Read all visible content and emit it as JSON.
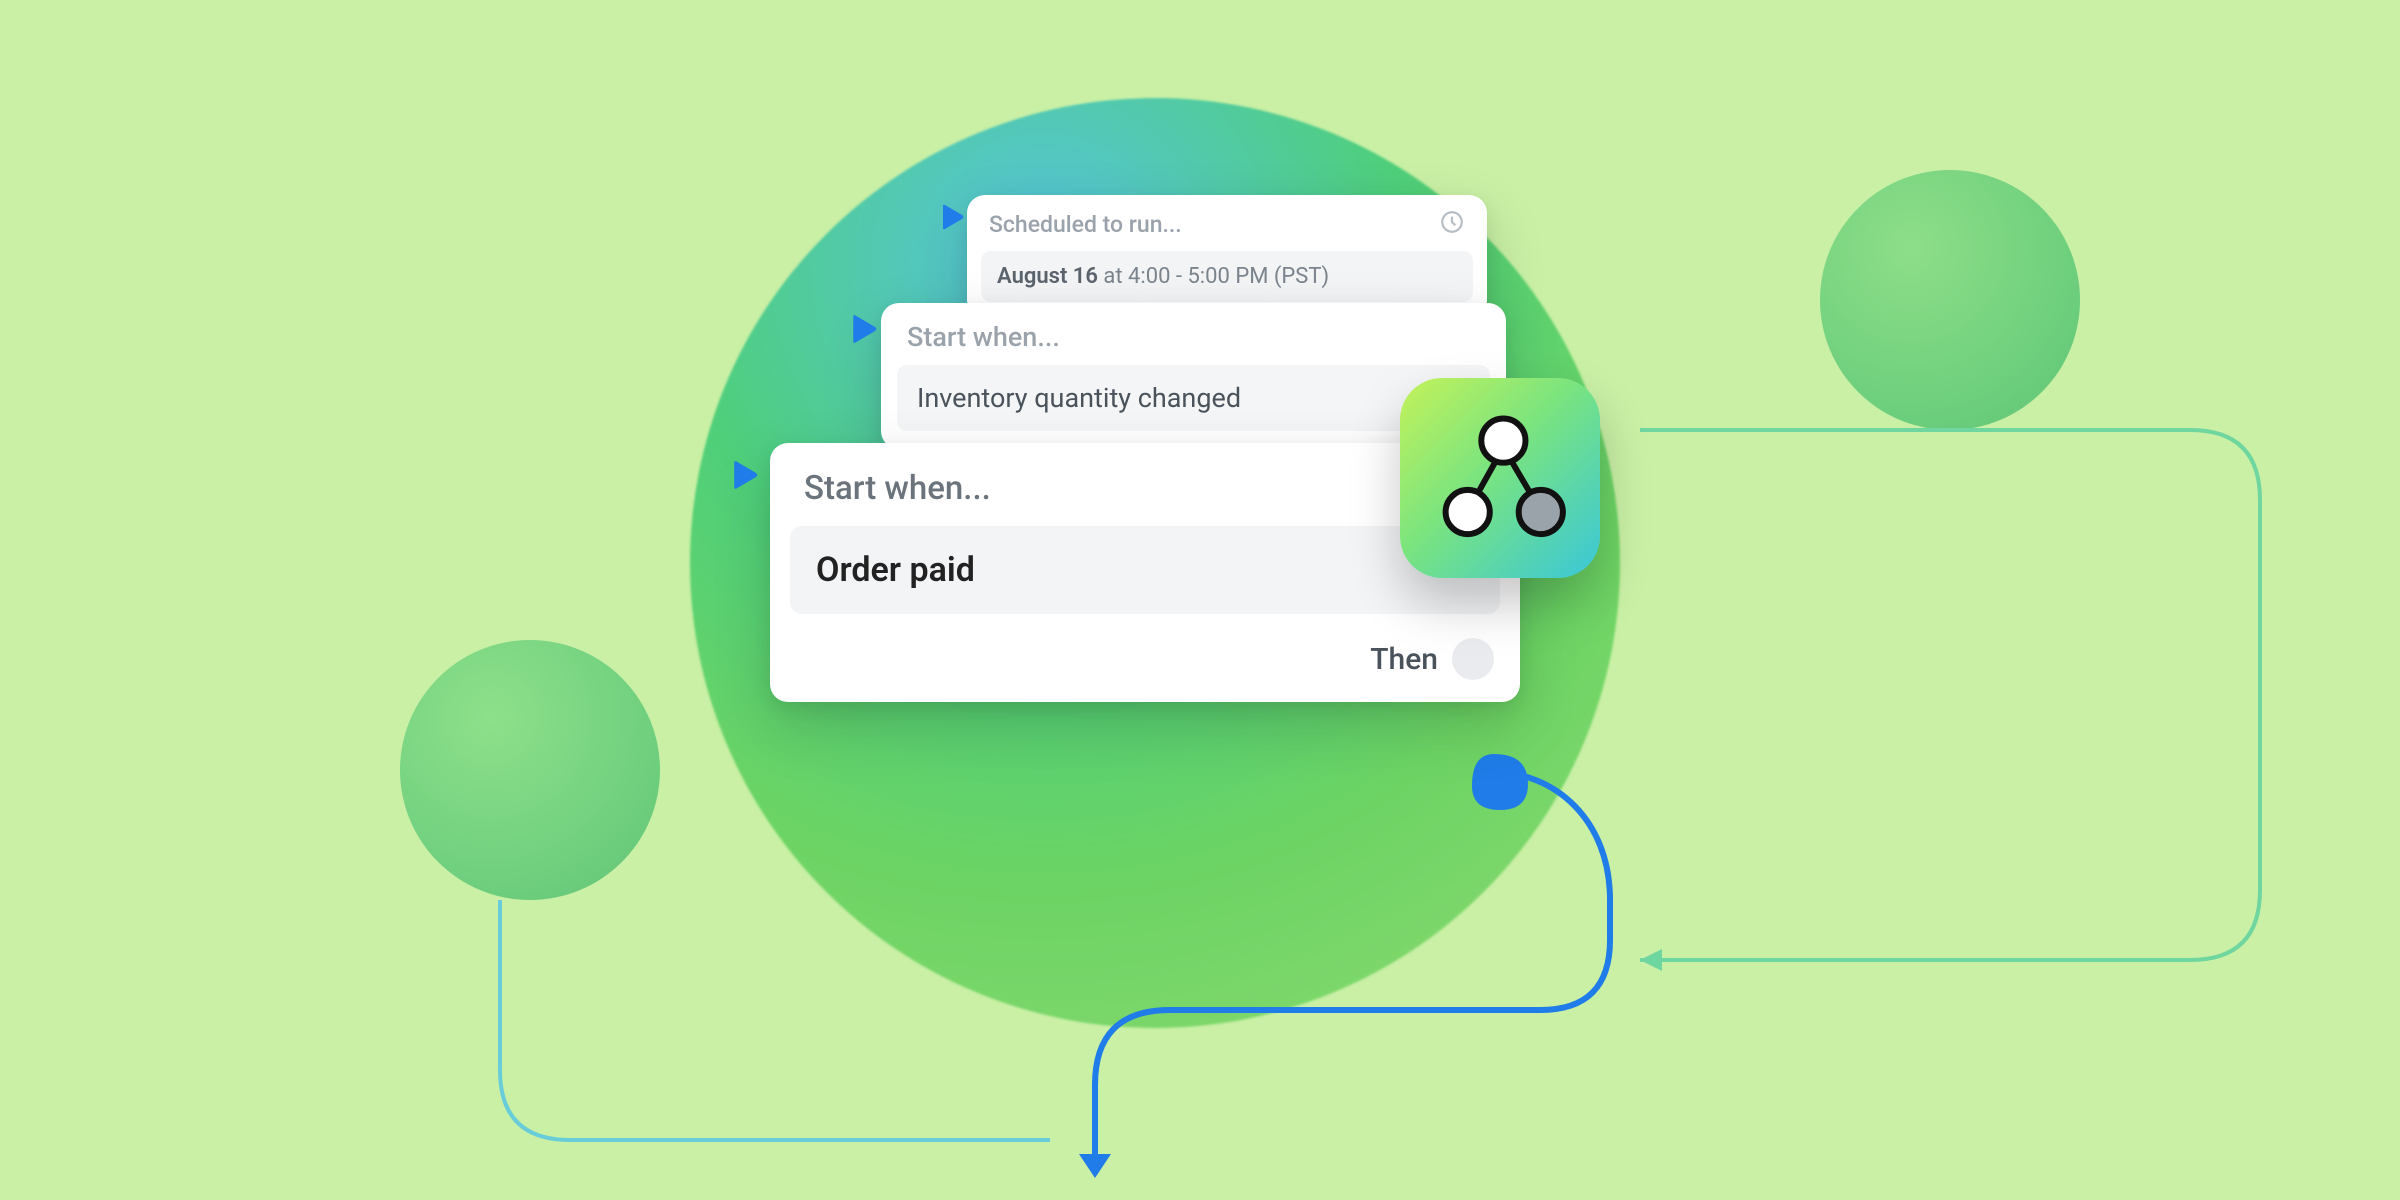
{
  "cards": {
    "scheduled": {
      "title": "Scheduled to run...",
      "date_prefix": "August 16",
      "date_rest": " at 4:00 - 5:00 PM (PST)"
    },
    "inventory": {
      "title": "Start when...",
      "value": "Inventory quantity changed"
    },
    "order": {
      "title": "Start when...",
      "value": "Order paid",
      "then": "Then"
    }
  },
  "icons": {
    "clock": "clock-icon",
    "play": "play-icon",
    "flow_app": "flow-graph-icon"
  },
  "colors": {
    "background": "#c9f0a5",
    "accent_blue": "#1f7ce8",
    "accent_teal": "#5fcfa8",
    "text_muted": "#9aa2ab"
  }
}
